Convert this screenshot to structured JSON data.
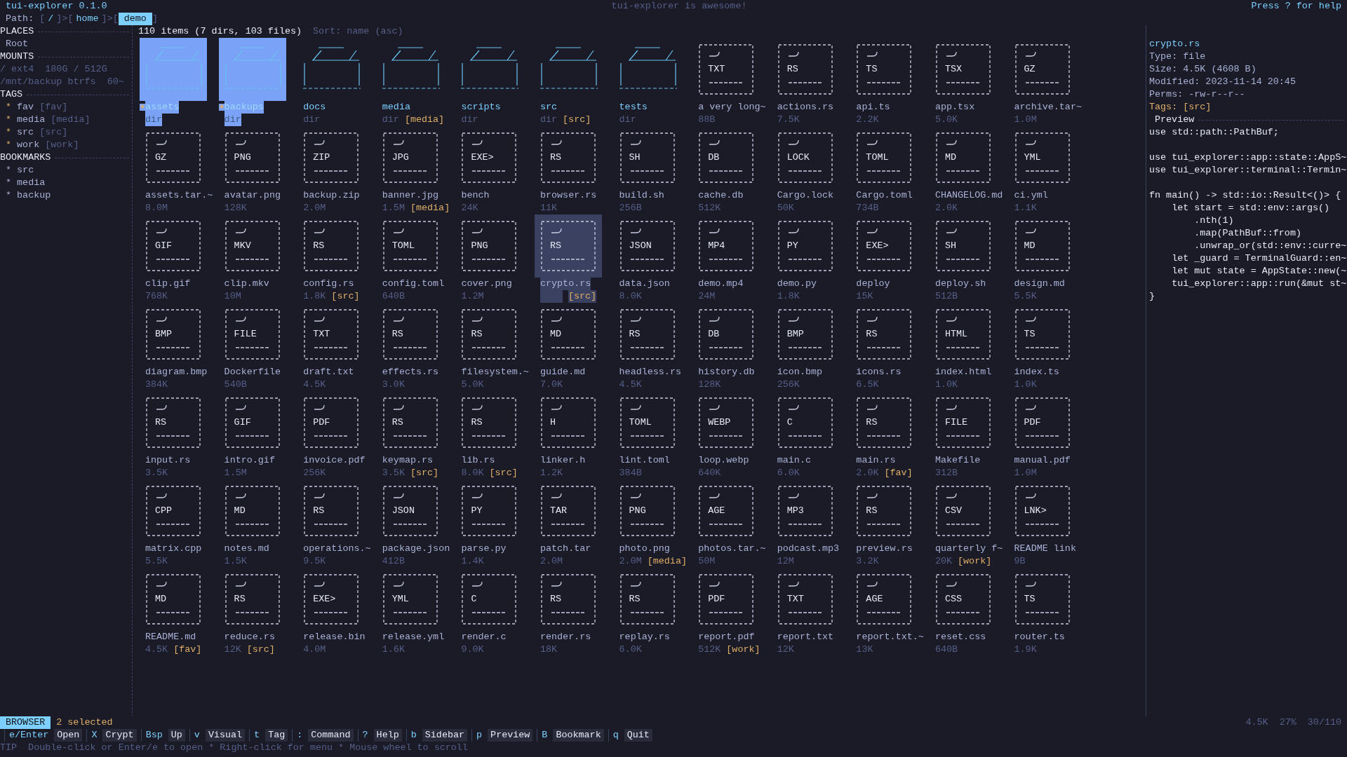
{
  "title_bar": {
    "app": "tui-explorer 0.1.0",
    "message": "tui-explorer is awesome!",
    "help": "Press ? for help"
  },
  "path": {
    "label": "Path:",
    "open": "[",
    "close": "]",
    "sep": ">",
    "crumbs": [
      {
        "label": "/",
        "selected": false
      },
      {
        "label": "home",
        "selected": false
      },
      {
        "label": "demo",
        "selected": true
      }
    ]
  },
  "sidebar": {
    "sections": [
      {
        "title": "PLACES",
        "items": [
          {
            "kind": "place",
            "text": "Root"
          }
        ]
      },
      {
        "title": "MOUNTS",
        "items": [
          {
            "kind": "mount",
            "text": "/ ext4  180G / 512G"
          },
          {
            "kind": "mount",
            "text": "/mnt/backup btrfs  60~"
          }
        ]
      },
      {
        "title": "TAGS",
        "items": [
          {
            "kind": "tag",
            "bullet": "*",
            "name": "fav",
            "tag": "[fav]"
          },
          {
            "kind": "tag",
            "bullet": "*",
            "name": "media",
            "tag": "[media]"
          },
          {
            "kind": "tag",
            "bullet": "*",
            "name": "src",
            "tag": "[src]"
          },
          {
            "kind": "tag",
            "bullet": "*",
            "name": "work",
            "tag": "[work]"
          }
        ]
      },
      {
        "title": "BOOKMARKS",
        "items": [
          {
            "kind": "bookmark",
            "text": "* src"
          },
          {
            "kind": "bookmark",
            "text": "* media"
          },
          {
            "kind": "bookmark",
            "text": "* backup"
          }
        ]
      }
    ]
  },
  "grid": {
    "summary": "110 items (7 dirs, 103 files)",
    "sort": "Sort: name (asc)",
    "items": [
      {
        "kind": "dir",
        "name": "assets",
        "meta": "dir",
        "selected": true,
        "focused": false
      },
      {
        "kind": "dir",
        "name": "backups",
        "meta": "dir",
        "selected": true,
        "focused": false
      },
      {
        "kind": "dir",
        "name": "docs",
        "meta": "dir",
        "selected": false,
        "focused": false
      },
      {
        "kind": "dir",
        "name": "media",
        "meta": "dir",
        "tag": "[media]",
        "selected": false,
        "focused": false
      },
      {
        "kind": "dir",
        "name": "scripts",
        "meta": "dir",
        "selected": false,
        "focused": false
      },
      {
        "kind": "dir",
        "name": "src",
        "meta": "dir",
        "tag": "[src]",
        "selected": false,
        "focused": false
      },
      {
        "kind": "dir",
        "name": "tests",
        "meta": "dir",
        "selected": false,
        "focused": false
      },
      {
        "kind": "file",
        "ext": "TXT",
        "name": "a very long~",
        "meta": "88B",
        "selected": false,
        "focused": false
      },
      {
        "kind": "file",
        "ext": "RS",
        "name": "actions.rs",
        "meta": "7.5K",
        "selected": false,
        "focused": false
      },
      {
        "kind": "file",
        "ext": "TS",
        "name": "api.ts",
        "meta": "2.2K",
        "selected": false,
        "focused": false
      },
      {
        "kind": "file",
        "ext": "TSX",
        "name": "app.tsx",
        "meta": "5.0K",
        "selected": false,
        "focused": false
      },
      {
        "kind": "file",
        "ext": "GZ",
        "name": "archive.tar~",
        "meta": "1.0M",
        "selected": false,
        "focused": false
      },
      {
        "kind": "file",
        "ext": "GZ",
        "name": "assets.tar.~",
        "meta": "8.0M",
        "selected": false,
        "focused": false
      },
      {
        "kind": "file",
        "ext": "PNG",
        "name": "avatar.png",
        "meta": "128K",
        "selected": false,
        "focused": false
      },
      {
        "kind": "file",
        "ext": "ZIP",
        "name": "backup.zip",
        "meta": "2.0M",
        "selected": false,
        "focused": false
      },
      {
        "kind": "file",
        "ext": "JPG",
        "name": "banner.jpg",
        "meta": "1.5M",
        "tag": "[media]",
        "selected": false,
        "focused": false
      },
      {
        "kind": "file",
        "ext": "EXE>",
        "name": "bench",
        "meta": "24K",
        "selected": false,
        "focused": false
      },
      {
        "kind": "file",
        "ext": "RS",
        "name": "browser.rs",
        "meta": "11K",
        "selected": false,
        "focused": false
      },
      {
        "kind": "file",
        "ext": "SH",
        "name": "build.sh",
        "meta": "256B",
        "selected": false,
        "focused": false
      },
      {
        "kind": "file",
        "ext": "DB",
        "name": "cache.db",
        "meta": "512K",
        "selected": false,
        "focused": false
      },
      {
        "kind": "file",
        "ext": "LOCK",
        "name": "Cargo.lock",
        "meta": "50K",
        "selected": false,
        "focused": false
      },
      {
        "kind": "file",
        "ext": "TOML",
        "name": "Cargo.toml",
        "meta": "734B",
        "selected": false,
        "focused": false
      },
      {
        "kind": "file",
        "ext": "MD",
        "name": "CHANGELOG.md",
        "meta": "2.0K",
        "selected": false,
        "focused": false
      },
      {
        "kind": "file",
        "ext": "YML",
        "name": "ci.yml",
        "meta": "1.1K",
        "selected": false,
        "focused": false
      },
      {
        "kind": "file",
        "ext": "GIF",
        "name": "clip.gif",
        "meta": "768K",
        "selected": false,
        "focused": false
      },
      {
        "kind": "file",
        "ext": "MKV",
        "name": "clip.mkv",
        "meta": "10M",
        "selected": false,
        "focused": false
      },
      {
        "kind": "file",
        "ext": "RS",
        "name": "config.rs",
        "meta": "1.8K",
        "tag": "[src]",
        "selected": false,
        "focused": false
      },
      {
        "kind": "file",
        "ext": "TOML",
        "name": "config.toml",
        "meta": "640B",
        "selected": false,
        "focused": false
      },
      {
        "kind": "file",
        "ext": "PNG",
        "name": "cover.png",
        "meta": "1.2M",
        "selected": false,
        "focused": false
      },
      {
        "kind": "file",
        "ext": "RS",
        "name": "crypto.rs",
        "tag": "[src]",
        "selected": false,
        "focused": true
      },
      {
        "kind": "file",
        "ext": "JSON",
        "name": "data.json",
        "meta": "8.0K",
        "selected": false,
        "focused": false
      },
      {
        "kind": "file",
        "ext": "MP4",
        "name": "demo.mp4",
        "meta": "24M",
        "selected": false,
        "focused": false
      },
      {
        "kind": "file",
        "ext": "PY",
        "name": "demo.py",
        "meta": "1.8K",
        "selected": false,
        "focused": false
      },
      {
        "kind": "file",
        "ext": "EXE>",
        "name": "deploy",
        "meta": "15K",
        "selected": false,
        "focused": false
      },
      {
        "kind": "file",
        "ext": "SH",
        "name": "deploy.sh",
        "meta": "512B",
        "selected": false,
        "focused": false
      },
      {
        "kind": "file",
        "ext": "MD",
        "name": "design.md",
        "meta": "5.5K",
        "selected": false,
        "focused": false
      },
      {
        "kind": "file",
        "ext": "BMP",
        "name": "diagram.bmp",
        "meta": "384K",
        "selected": false,
        "focused": false
      },
      {
        "kind": "file",
        "ext": "FILE",
        "name": "Dockerfile",
        "meta": "540B",
        "selected": false,
        "focused": false
      },
      {
        "kind": "file",
        "ext": "TXT",
        "name": "draft.txt",
        "meta": "4.5K",
        "selected": false,
        "focused": false
      },
      {
        "kind": "file",
        "ext": "RS",
        "name": "effects.rs",
        "meta": "3.0K",
        "selected": false,
        "focused": false
      },
      {
        "kind": "file",
        "ext": "RS",
        "name": "filesystem.~",
        "meta": "5.0K",
        "selected": false,
        "focused": false
      },
      {
        "kind": "file",
        "ext": "MD",
        "name": "guide.md",
        "meta": "7.0K",
        "selected": false,
        "focused": false
      },
      {
        "kind": "file",
        "ext": "RS",
        "name": "headless.rs",
        "meta": "4.5K",
        "selected": false,
        "focused": false
      },
      {
        "kind": "file",
        "ext": "DB",
        "name": "history.db",
        "meta": "128K",
        "selected": false,
        "focused": false
      },
      {
        "kind": "file",
        "ext": "BMP",
        "name": "icon.bmp",
        "meta": "256K",
        "selected": false,
        "focused": false
      },
      {
        "kind": "file",
        "ext": "RS",
        "name": "icons.rs",
        "meta": "6.5K",
        "selected": false,
        "focused": false
      },
      {
        "kind": "file",
        "ext": "HTML",
        "name": "index.html",
        "meta": "1.0K",
        "selected": false,
        "focused": false
      },
      {
        "kind": "file",
        "ext": "TS",
        "name": "index.ts",
        "meta": "1.0K",
        "selected": false,
        "focused": false
      },
      {
        "kind": "file",
        "ext": "RS",
        "name": "input.rs",
        "meta": "3.5K",
        "selected": false,
        "focused": false
      },
      {
        "kind": "file",
        "ext": "GIF",
        "name": "intro.gif",
        "meta": "1.5M",
        "selected": false,
        "focused": false
      },
      {
        "kind": "file",
        "ext": "PDF",
        "name": "invoice.pdf",
        "meta": "256K",
        "selected": false,
        "focused": false
      },
      {
        "kind": "file",
        "ext": "RS",
        "name": "keymap.rs",
        "meta": "3.5K",
        "tag": "[src]",
        "selected": false,
        "focused": false
      },
      {
        "kind": "file",
        "ext": "RS",
        "name": "lib.rs",
        "meta": "8.0K",
        "tag": "[src]",
        "selected": false,
        "focused": false
      },
      {
        "kind": "file",
        "ext": "H",
        "name": "linker.h",
        "meta": "1.2K",
        "selected": false,
        "focused": false
      },
      {
        "kind": "file",
        "ext": "TOML",
        "name": "lint.toml",
        "meta": "384B",
        "selected": false,
        "focused": false
      },
      {
        "kind": "file",
        "ext": "WEBP",
        "name": "loop.webp",
        "meta": "640K",
        "selected": false,
        "focused": false
      },
      {
        "kind": "file",
        "ext": "C",
        "name": "main.c",
        "meta": "6.0K",
        "selected": false,
        "focused": false
      },
      {
        "kind": "file",
        "ext": "RS",
        "name": "main.rs",
        "meta": "2.0K",
        "tag": "[fav]",
        "selected": false,
        "focused": false
      },
      {
        "kind": "file",
        "ext": "FILE",
        "name": "Makefile",
        "meta": "312B",
        "selected": false,
        "focused": false
      },
      {
        "kind": "file",
        "ext": "PDF",
        "name": "manual.pdf",
        "meta": "1.0M",
        "selected": false,
        "focused": false
      },
      {
        "kind": "file",
        "ext": "CPP",
        "name": "matrix.cpp",
        "meta": "5.5K",
        "selected": false,
        "focused": false
      },
      {
        "kind": "file",
        "ext": "MD",
        "name": "notes.md",
        "meta": "1.5K",
        "selected": false,
        "focused": false
      },
      {
        "kind": "file",
        "ext": "RS",
        "name": "operations.~",
        "meta": "9.5K",
        "selected": false,
        "focused": false
      },
      {
        "kind": "file",
        "ext": "JSON",
        "name": "package.json",
        "meta": "412B",
        "selected": false,
        "focused": false
      },
      {
        "kind": "file",
        "ext": "PY",
        "name": "parse.py",
        "meta": "1.4K",
        "selected": false,
        "focused": false
      },
      {
        "kind": "file",
        "ext": "TAR",
        "name": "patch.tar",
        "meta": "2.0M",
        "selected": false,
        "focused": false
      },
      {
        "kind": "file",
        "ext": "PNG",
        "name": "photo.png",
        "meta": "2.0M",
        "tag": "[media]",
        "selected": false,
        "focused": false
      },
      {
        "kind": "file",
        "ext": "AGE",
        "name": "photos.tar.~",
        "meta": "50M",
        "selected": false,
        "focused": false
      },
      {
        "kind": "file",
        "ext": "MP3",
        "name": "podcast.mp3",
        "meta": "12M",
        "selected": false,
        "focused": false
      },
      {
        "kind": "file",
        "ext": "RS",
        "name": "preview.rs",
        "meta": "3.2K",
        "selected": false,
        "focused": false
      },
      {
        "kind": "file",
        "ext": "CSV",
        "name": "quarterly f~",
        "meta": "20K",
        "tag": "[work]",
        "selected": false,
        "focused": false
      },
      {
        "kind": "file",
        "ext": "LNK>",
        "name": "README link",
        "meta": "9B",
        "selected": false,
        "focused": false
      },
      {
        "kind": "file",
        "ext": "MD",
        "name": "README.md",
        "meta": "4.5K",
        "tag": "[fav]",
        "selected": false,
        "focused": false
      },
      {
        "kind": "file",
        "ext": "RS",
        "name": "reduce.rs",
        "meta": "12K",
        "tag": "[src]",
        "selected": false,
        "focused": false
      },
      {
        "kind": "file",
        "ext": "EXE>",
        "name": "release.bin",
        "meta": "4.0M",
        "selected": false,
        "focused": false
      },
      {
        "kind": "file",
        "ext": "YML",
        "name": "release.yml",
        "meta": "1.6K",
        "selected": false,
        "focused": false
      },
      {
        "kind": "file",
        "ext": "C",
        "name": "render.c",
        "meta": "9.0K",
        "selected": false,
        "focused": false
      },
      {
        "kind": "file",
        "ext": "RS",
        "name": "render.rs",
        "meta": "18K",
        "selected": false,
        "focused": false
      },
      {
        "kind": "file",
        "ext": "RS",
        "name": "replay.rs",
        "meta": "6.0K",
        "selected": false,
        "focused": false
      },
      {
        "kind": "file",
        "ext": "PDF",
        "name": "report.pdf",
        "meta": "512K",
        "tag": "[work]",
        "selected": false,
        "focused": false
      },
      {
        "kind": "file",
        "ext": "TXT",
        "name": "report.txt",
        "meta": "12K",
        "selected": false,
        "focused": false
      },
      {
        "kind": "file",
        "ext": "AGE",
        "name": "report.txt.~",
        "meta": "13K",
        "selected": false,
        "focused": false
      },
      {
        "kind": "file",
        "ext": "CSS",
        "name": "reset.css",
        "meta": "640B",
        "selected": false,
        "focused": false
      },
      {
        "kind": "file",
        "ext": "TS",
        "name": "router.ts",
        "meta": "1.9K",
        "selected": false,
        "focused": false
      }
    ]
  },
  "details": {
    "name": "crypto.rs",
    "lines": [
      {
        "kind": "info",
        "text": "Type: file"
      },
      {
        "kind": "info",
        "text": "Size: 4.5K (4608 B)"
      },
      {
        "kind": "info",
        "text": "Modified: 2023-11-14 20:45"
      },
      {
        "kind": "info",
        "text": "Perms: -rw-r--r--"
      },
      {
        "kind": "tags",
        "text": "Tags: [src]"
      }
    ],
    "preview_title": "Preview",
    "preview_code": "use std::path::PathBuf;\n\nuse tui_explorer::app::state::AppS~\nuse tui_explorer::terminal::Termin~\n\nfn main() -> std::io::Result<()> {\n    let start = std::env::args()\n        .nth(1)\n        .map(PathBuf::from)\n        .unwrap_or(std::env::curre~\n    let _guard = TerminalGuard::en~\n    let mut state = AppState::new(~\n    tui_explorer::app::run(&mut st~\n}"
  },
  "status": {
    "mode": "BROWSER",
    "selection": "2 selected",
    "stats": [
      "4.5K",
      "27%",
      "30/110"
    ]
  },
  "keys": [
    {
      "key": "e/Enter",
      "label": "Open"
    },
    {
      "key": "X",
      "label": "Crypt"
    },
    {
      "key": "Bsp",
      "label": "Up"
    },
    {
      "key": "v",
      "label": "Visual"
    },
    {
      "key": "t",
      "label": "Tag"
    },
    {
      "key": ":",
      "label": "Command"
    },
    {
      "key": "?",
      "label": "Help"
    },
    {
      "key": "b",
      "label": "Sidebar"
    },
    {
      "key": "p",
      "label": "Preview"
    },
    {
      "key": "B",
      "label": "Bookmark"
    },
    {
      "key": "q",
      "label": "Quit"
    }
  ],
  "tip": {
    "label": "TIP",
    "text": "Double-click or Enter/e to open * Right-click for menu * Mouse wheel to scroll"
  }
}
